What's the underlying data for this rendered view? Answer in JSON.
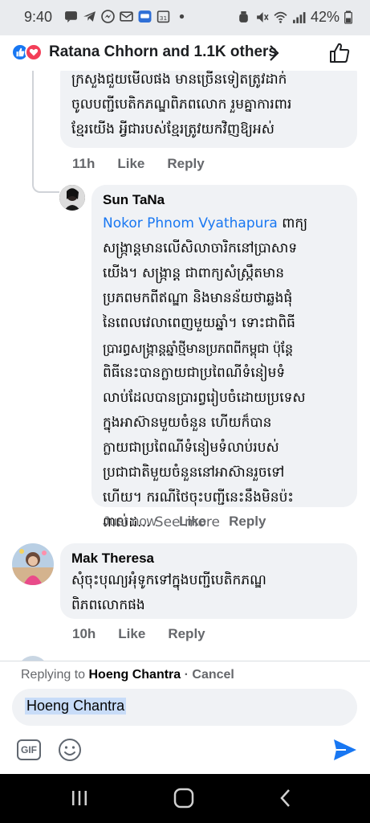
{
  "status_bar": {
    "time": "9:40",
    "battery": "42%",
    "icons": [
      "chat-icon",
      "telegram-icon",
      "messenger-icon",
      "mail-icon",
      "app-icon",
      "calendar-icon",
      "dot-icon"
    ],
    "right_icons": [
      "alarm-icon",
      "mute-icon",
      "wifi-icon",
      "signal-icon",
      "battery-icon"
    ]
  },
  "reactions": {
    "summary": "Ratana Chhorn and 1.1K others",
    "like_color": "#1877f2",
    "love_color": "#f33e58"
  },
  "comments": [
    {
      "text_lines": [
        "ក្រសួងជួយមើលផង មានច្រើនទៀតត្រូវដាក់",
        "ចូលបញ្ជីបេតិកភណ្ឌពិភពលោក រួមគ្នាការពារ",
        "ខ្មែរយើង អ្វីជារបស់ខ្មែរត្រូវយកវិញឱ្យអស់"
      ],
      "time": "11h",
      "like": "Like",
      "reply": "Reply"
    },
    {
      "author": "Sun TaNa",
      "mention": "Nokor Phnom Vyathapura",
      "first_line_rest": " ពាក្យ",
      "text_lines": [
        "សង្ក្រាន្តមានលើសិលាចារិកនៅប្រាសាទ",
        "យើង។ សង្ក្រាន្ត ជាពាក្យសំស្ក្រឹតមាន",
        "ប្រភពមកពីឥណ្ឌា និងមានន័យថាឆ្លងផុំ",
        "នៃពេលវេលាពេញមួយឆ្នាំ។ ទោះជាពិធី",
        "ប្រារព្ធសង្ក្រាន្តឆ្នាំថ្មីមានប្រភពពីកម្ពុជា ប៉ុន្តែ",
        "ពិធីនេះបានក្លាយជាប្រពៃណីទំនៀមទំ",
        "លាប់ដែលបានប្រារព្វរៀបចំដោយប្រទេស",
        "ក្នុងអាស៊ានមួយចំនួន ហើយក៏បាន",
        "ក្លាយជាប្រពៃណីទំនៀមទំលាប់របស់",
        "ប្រជាជាតិមួយចំនួននៅអាស៊ានរួចទៅ",
        "ហើយ។ ករណីថៃចុះបញ្ជីនេះនឹងមិនប៉ះ"
      ],
      "last_line": "ពាល់ដ...",
      "see_more": " See more",
      "time": "Just now",
      "like": "Like",
      "reply": "Reply"
    },
    {
      "author": "Mak Theresa",
      "text_lines": [
        "សុំចុះបុណ្យអុំទូកទៅក្នុងបញ្ជីបេតិកភណ្ឌ",
        "ពិភពលោកផង"
      ],
      "time": "10h",
      "like": "Like",
      "reply": "Reply"
    }
  ],
  "reply_bar": {
    "replying_prefix": "Replying to ",
    "replying_name": "Hoeng Chantra",
    "cancel": " · Cancel",
    "input_value": "Hoeng Chantra",
    "gif_label": "GIF",
    "accent": "#1877f2"
  },
  "nav": [
    "recent-apps-icon",
    "home-icon",
    "back-icon"
  ]
}
